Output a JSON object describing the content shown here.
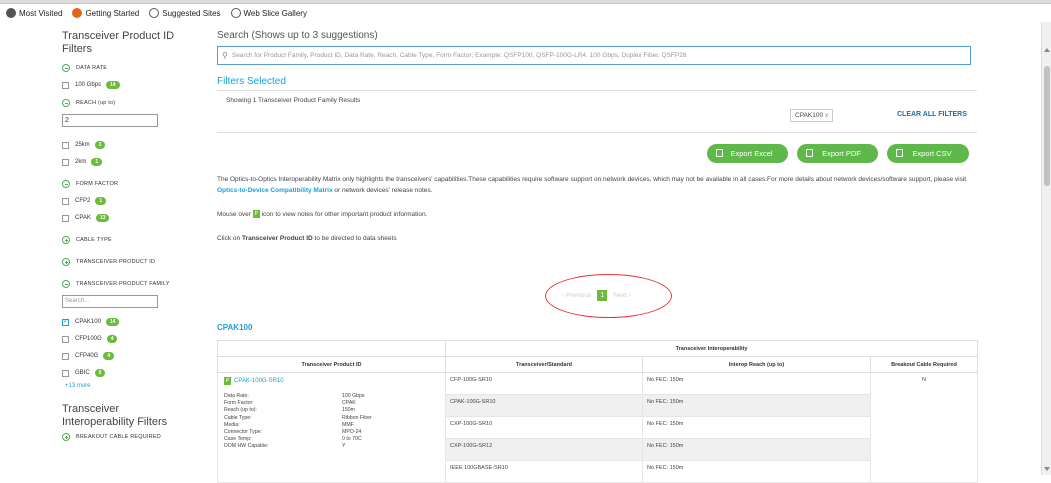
{
  "bookmarks": [
    "Most Visited",
    "Getting Started",
    "Suggested Sites",
    "Web Slice Gallery"
  ],
  "sidebar": {
    "title": "Transceiver Product ID Filters",
    "data_rate": {
      "label": "DATA RATE",
      "options": [
        {
          "label": "100 Gbps",
          "count": "14"
        }
      ]
    },
    "reach": {
      "label": "REACH (up to)",
      "input_value": "2",
      "options": [
        {
          "label": "25km",
          "count": "3"
        },
        {
          "label": "2km",
          "count": "1"
        }
      ]
    },
    "form_factor": {
      "label": "FORM FACTOR",
      "options": [
        {
          "label": "CFP2",
          "count": "1"
        },
        {
          "label": "CPAK",
          "count": "13"
        }
      ]
    },
    "cable_type": "CABLE TYPE",
    "transceiver_product_id": "TRANSCEIVER PRODUCT ID",
    "transceiver_product_family": {
      "label": "TRANSCEIVER PRODUCT FAMILY",
      "search_placeholder": "Search...",
      "options": [
        {
          "label": "CPAK100",
          "count": "14"
        },
        {
          "label": "CFP100G",
          "count": "4"
        },
        {
          "label": "CFP40G",
          "count": "4"
        },
        {
          "label": "GBIC",
          "count": "5"
        }
      ],
      "more": "+13 more"
    },
    "title2": "Transceiver Interoperability Filters",
    "breakout": "BREAKOUT CABLE REQUIRED"
  },
  "main": {
    "search_label": "Search (Shows up to 3 suggestions)",
    "search_placeholder": "Search for Product Family, Product ID, Data Rate, Reach, Cable Type, Form Factor;  Example: QSFP100, QSFP-100G-LR4, 100 Gbps, Duplex Fiber, QSFP28",
    "filters_selected": "Filters Selected",
    "results_text": "Showing 1 Transceiver Product Family Results",
    "chip": "CPAK100",
    "chip_close": "x",
    "clear_all": "CLEAR ALL FILTERS",
    "export_excel": "Export Excel",
    "export_pdf": "Export PDF",
    "export_csv": "Export CSV",
    "para1_a": "The Optics-to-Optics Interoperability Matrix only highlights the transceivers' capabilities.These capabilities require software support on network devices, which may not be available in all cases.For more details about network devices/software support, please visit ",
    "para1_link": "Optics-to-Device Compatibility Matrix",
    "para1_b": " or network devices' release notes.",
    "para2_a": "Mouse over ",
    "para2_icon": "P",
    "para2_b": " icon to view notes for other important product information.",
    "para3_a": "Click on ",
    "para3_bold": "Transceiver Product ID",
    "para3_b": " to be directed to data sheets",
    "pager_prev": "‹  Previous",
    "pager_page": "1",
    "pager_next": "Next  ›",
    "family_title": "CPAK100"
  },
  "table": {
    "group_header": "Transceiver Interoperability",
    "headers": [
      "Transceiver Product ID",
      "Transceiver/Standard",
      "Interop Reach (up to)",
      "Breakout Cable Required"
    ],
    "product_id": "CPAK-100G-SR10",
    "specs": [
      [
        "Data Rate:",
        "100 Gbps"
      ],
      [
        "Form Factor:",
        "CPAK"
      ],
      [
        "Reach (up to):",
        "150m"
      ],
      [
        "Cable Type:",
        "Ribbon Fiber"
      ],
      [
        "Media:",
        "MMF"
      ],
      [
        "Connector Type:",
        "MPO-24"
      ],
      [
        "Case Temp:",
        "0 to 70C"
      ],
      [
        "DOM HW Capable:",
        "Y"
      ]
    ],
    "rows": [
      {
        "standard": "CFP-100G-SR10",
        "reach": "No FEC: 150m",
        "breakout": "N"
      },
      {
        "standard": "CPAK-100G-SR10",
        "reach": "No FEC: 150m",
        "breakout": ""
      },
      {
        "standard": "CXP-100G-SR10",
        "reach": "No FEC: 150m",
        "breakout": ""
      },
      {
        "standard": "CXP-100G-SR12",
        "reach": "No FEC: 150m",
        "breakout": ""
      },
      {
        "standard": "IEEE 100GBASE-SR10",
        "reach": "No FEC: 150m",
        "breakout": ""
      }
    ]
  }
}
